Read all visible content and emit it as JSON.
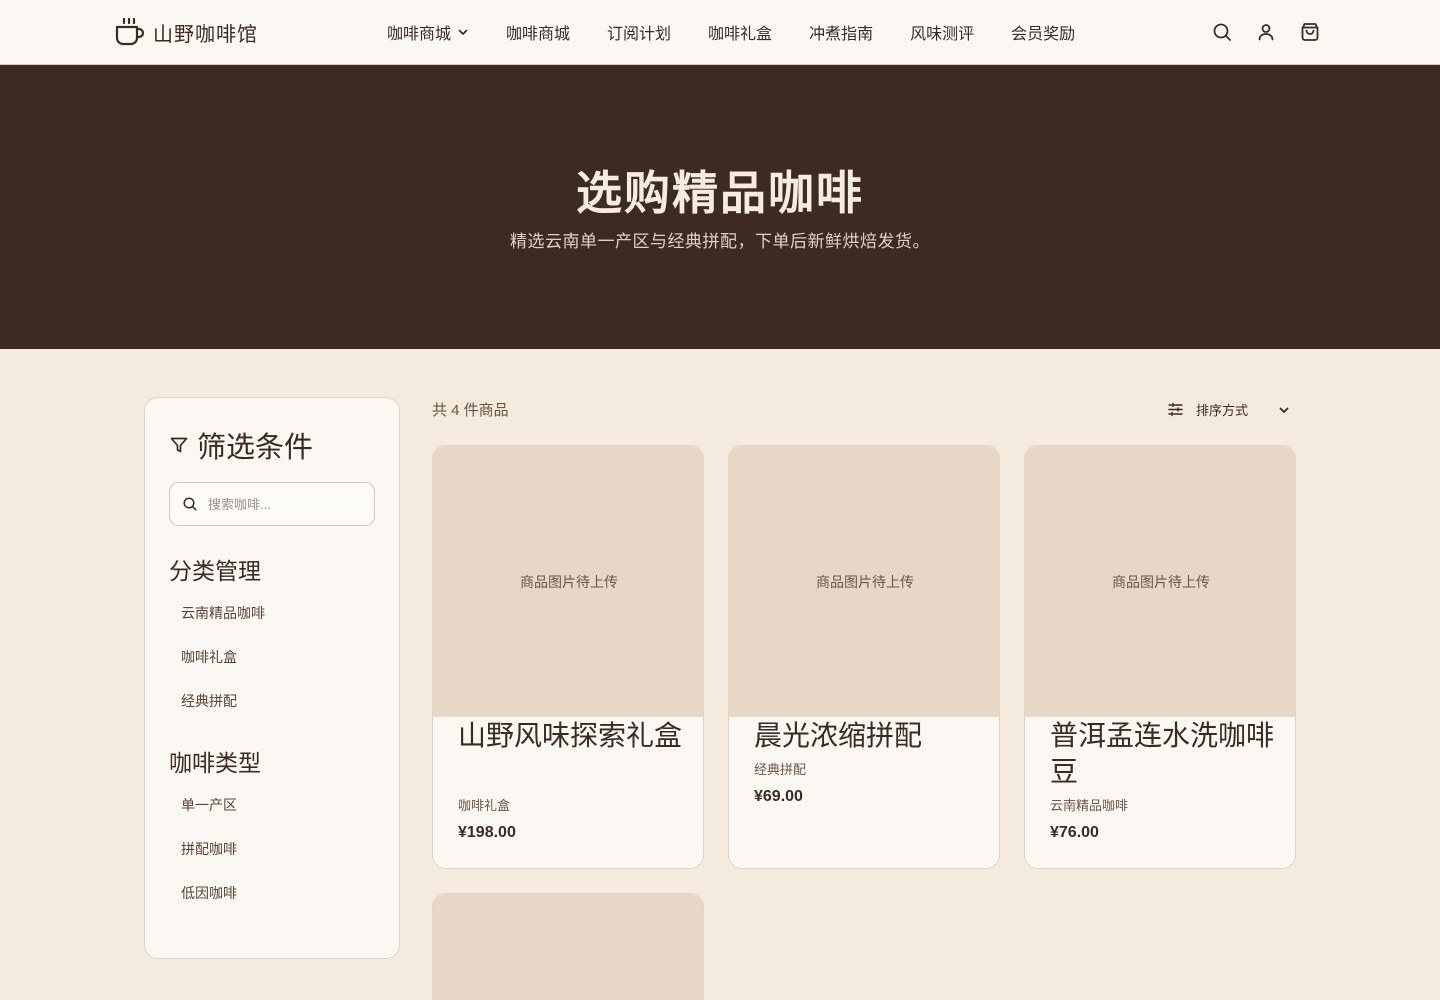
{
  "header": {
    "logo_text": "山野咖啡馆",
    "nav": [
      {
        "label": "咖啡商城",
        "has_dropdown": true
      },
      {
        "label": "咖啡商城",
        "has_dropdown": false
      },
      {
        "label": "订阅计划",
        "has_dropdown": false
      },
      {
        "label": "咖啡礼盒",
        "has_dropdown": false
      },
      {
        "label": "冲煮指南",
        "has_dropdown": false
      },
      {
        "label": "风味测评",
        "has_dropdown": false
      },
      {
        "label": "会员奖励",
        "has_dropdown": false
      }
    ],
    "icons": [
      "search-icon",
      "user-icon",
      "cart-icon"
    ]
  },
  "hero": {
    "title": "选购精品咖啡",
    "subtitle": "精选云南单一产区与经典拼配，下单后新鲜烘焙发货。"
  },
  "sidebar": {
    "title": "筛选条件",
    "search_placeholder": "搜索咖啡...",
    "category_title": "分类管理",
    "categories": [
      "云南精品咖啡",
      "咖啡礼盒",
      "经典拼配"
    ],
    "type_title": "咖啡类型",
    "types": [
      "单一产区",
      "拼配咖啡",
      "低因咖啡"
    ]
  },
  "toolbar": {
    "count_text": "共 4 件商品",
    "sort_label": "排序方式"
  },
  "products": [
    {
      "image_placeholder": "商品图片待上传",
      "name": "山野风味探索礼盒",
      "category": "咖啡礼盒",
      "price": "¥198.00"
    },
    {
      "image_placeholder": "商品图片待上传",
      "name": "晨光浓缩拼配",
      "category": "经典拼配",
      "price": "¥69.00"
    },
    {
      "image_placeholder": "商品图片待上传",
      "name": "普洱孟连水洗咖啡豆",
      "category": "云南精品咖啡",
      "price": "¥76.00"
    },
    {
      "image_placeholder": "",
      "name": "",
      "category": "",
      "price": ""
    }
  ],
  "colors": {
    "page_bg": "#f4eadd",
    "hero_bg": "#3d2a22",
    "card_bg": "#fbf8f4",
    "image_bg": "#e6d7c6",
    "text": "#3b2a22"
  }
}
